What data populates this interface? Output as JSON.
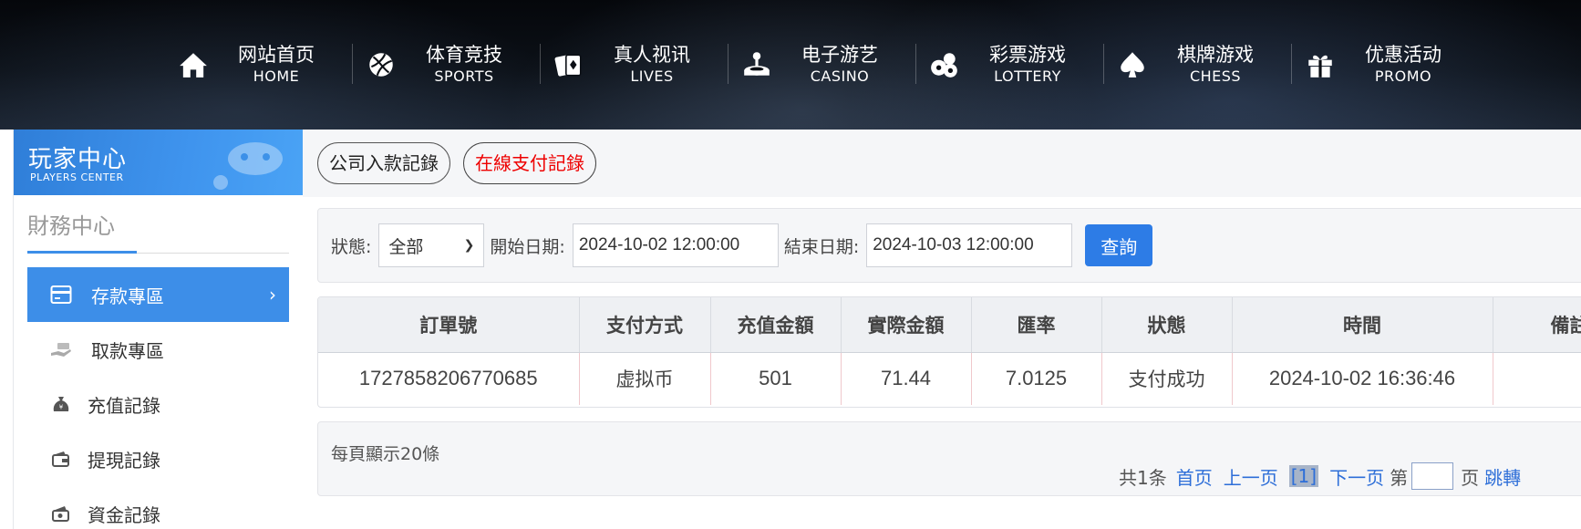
{
  "nav": [
    {
      "cn": "网站首页",
      "en": "HOME",
      "icon": "home-icon"
    },
    {
      "cn": "体育竞技",
      "en": "SPORTS",
      "icon": "ball-icon"
    },
    {
      "cn": "真人视讯",
      "en": "LIVES",
      "icon": "cards-icon"
    },
    {
      "cn": "电子游艺",
      "en": "CASINO",
      "icon": "joystick-icon"
    },
    {
      "cn": "彩票游戏",
      "en": "LOTTERY",
      "icon": "lottery-balls-icon"
    },
    {
      "cn": "棋牌游戏",
      "en": "CHESS",
      "icon": "spade-icon"
    },
    {
      "cn": "优惠活动",
      "en": "PROMO",
      "icon": "gift-icon"
    }
  ],
  "sidebar": {
    "banner_cn": "玩家中心",
    "banner_en": "PLAYERS CENTER",
    "section_title": "財務中心",
    "items": [
      {
        "label": "存款專區",
        "icon": "card-icon",
        "active": true
      },
      {
        "label": "取款專區",
        "icon": "hand-cash-icon",
        "active": false
      },
      {
        "label": "充值記錄",
        "icon": "money-bag-icon",
        "active": false
      },
      {
        "label": "提現記錄",
        "icon": "wallet-icon",
        "active": false
      },
      {
        "label": "資金記錄",
        "icon": "record-icon",
        "active": false
      }
    ]
  },
  "tabs": [
    {
      "label": "公司入款記錄",
      "active": false
    },
    {
      "label": "在線支付記錄",
      "active": true
    }
  ],
  "filter": {
    "status_label": "狀態:",
    "status_value": "全部",
    "start_label": "開始日期:",
    "start_value": "2024-10-02 12:00:00",
    "end_label": "結束日期:",
    "end_value": "2024-10-03 12:00:00",
    "query_label": "查詢"
  },
  "table": {
    "headers": [
      "訂單號",
      "支付方式",
      "充值金額",
      "實際金額",
      "匯率",
      "狀態",
      "時間",
      "備註"
    ],
    "rows": [
      [
        "1727858206770685",
        "虚拟币",
        "501",
        "71.44",
        "7.0125",
        "支付成功",
        "2024-10-02 16:36:46",
        ""
      ]
    ]
  },
  "pager": {
    "per_page": "每頁顯示20條",
    "total": "共1条",
    "first": "首页",
    "prev": "上一页",
    "current": "[1]",
    "next": "下一页",
    "goto_prefix": "第",
    "goto_suffix": "页",
    "jump": "跳轉"
  },
  "colors": {
    "accent": "#3d8ee8",
    "query_button": "#2d7ce6",
    "active_tab_text": "#ee0000",
    "link": "#2d6ed8"
  }
}
